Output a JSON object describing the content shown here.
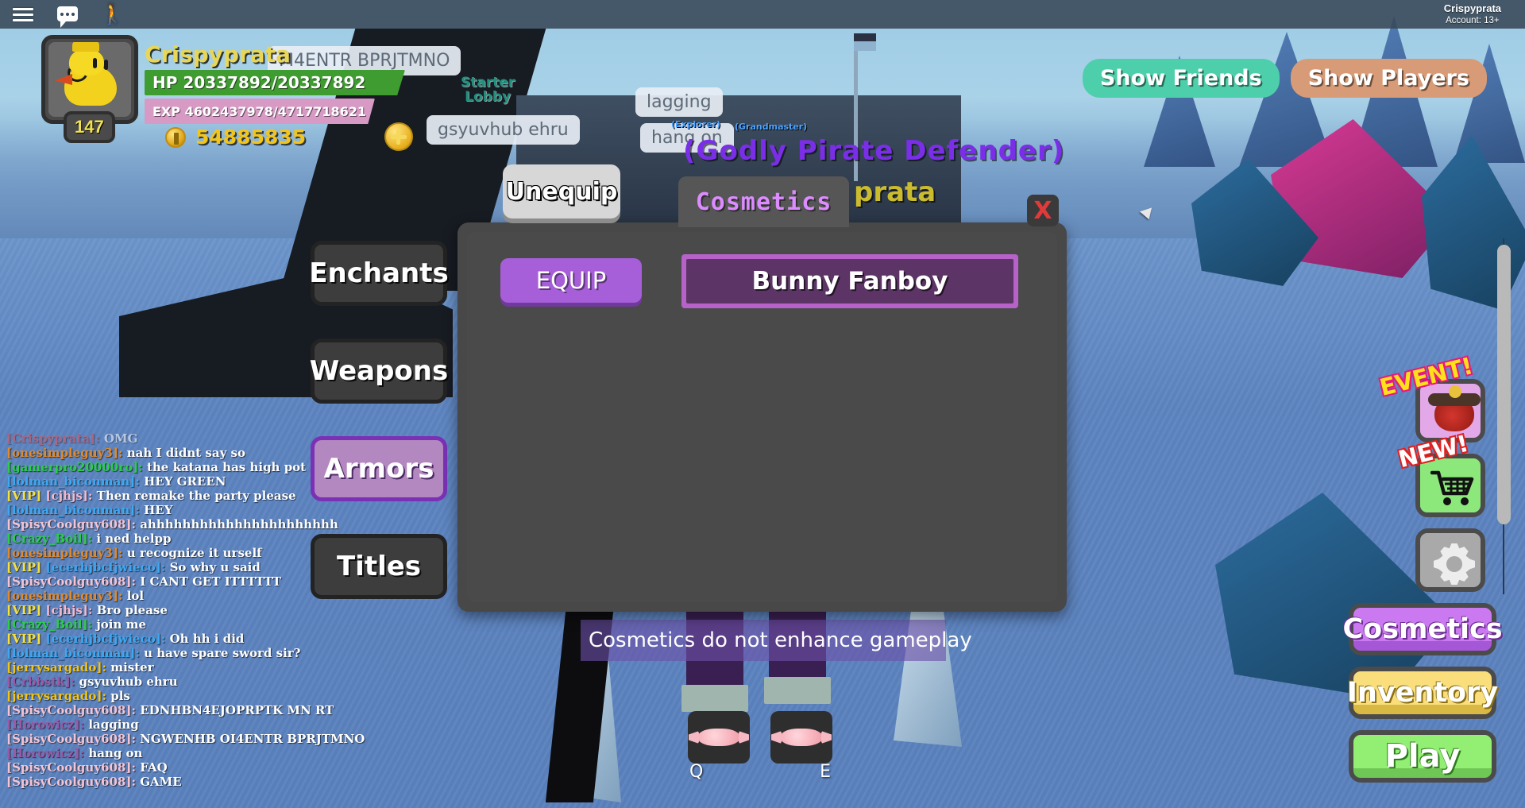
{
  "topbar": {
    "menu_icon": "hamburger-icon",
    "chat_icon": "chat-icon",
    "emote_icon": "person-emote-icon",
    "account_name": "Crispyprata",
    "account_age": "Account: 13+"
  },
  "hud": {
    "player_name": "Crispyprata",
    "level": "147",
    "hp_text": "HP 20337892/20337892",
    "exp_text": "EXP 4602437978/4717718621",
    "coins": "54885835",
    "add_coins_label": "+"
  },
  "top_right": {
    "show_friends": "Show Friends",
    "show_players": "Show Players"
  },
  "world": {
    "starter_lobby": "Starter\nLobby",
    "bubbles": [
      {
        "text": "М4ENTR BPRJTMNO"
      },
      {
        "text": "lagging"
      },
      {
        "text": "gsyuvhub ehru"
      },
      {
        "text": "hang on"
      }
    ],
    "overhead_titles": {
      "godly": "(Godly Pirate Defender)",
      "player": "prata",
      "grandmaster": "(Grandmaster)",
      "explorer": "(Explorer)"
    }
  },
  "left_tabs": [
    {
      "label": "Enchants",
      "active": false
    },
    {
      "label": "Weapons",
      "active": false
    },
    {
      "label": "Armors",
      "active": true
    },
    {
      "label": "Titles",
      "active": false
    }
  ],
  "modal": {
    "title": "Cosmetics",
    "close_label": "X",
    "equip_label": "EQUIP",
    "items": [
      {
        "name": "Bunny Fanboy",
        "selected": true
      }
    ]
  },
  "tooltip": {
    "unequip_label": "Unequip"
  },
  "banner": {
    "text": "Cosmetics do not enhance gameplay"
  },
  "hotbar": [
    {
      "key": "Q",
      "icon": "candy-icon"
    },
    {
      "key": "E",
      "icon": "candy-icon"
    }
  ],
  "right_rail": [
    {
      "type": "icon",
      "name": "event-button",
      "icon": "kabuto-helmet-icon",
      "flag": "EVENT!"
    },
    {
      "type": "icon",
      "name": "shop-button",
      "icon": "shopping-cart-icon",
      "flag": "NEW!"
    },
    {
      "type": "icon",
      "name": "settings-button",
      "icon": "gear-icon",
      "flag": ""
    },
    {
      "type": "text",
      "name": "cosmetics-button",
      "label": "Cosmetics"
    },
    {
      "type": "text",
      "name": "inventory-button",
      "label": "Inventory"
    },
    {
      "type": "text",
      "name": "play-button",
      "label": "Play"
    }
  ],
  "chat": [
    {
      "vip": false,
      "who": "[Crispyprata]:",
      "who_color": "#e05050",
      "msg": "OMG"
    },
    {
      "vip": false,
      "who": "[onesimpleguy3]:",
      "who_color": "#e08a2e",
      "msg": "nah I didnt say so"
    },
    {
      "vip": false,
      "who": "[gamerpro20000ro]:",
      "who_color": "#2ecc4a",
      "msg": "the katana has high pot"
    },
    {
      "vip": false,
      "who": "[lolman_biconman]:",
      "who_color": "#3ea8f0",
      "msg": "HEY GREEN"
    },
    {
      "vip": true,
      "who": "[cjhjs]:",
      "who_color": "#f3b9cc",
      "msg": "Then remake the party please"
    },
    {
      "vip": false,
      "who": "[lolman_biconman]:",
      "who_color": "#3ea8f0",
      "msg": "HEY"
    },
    {
      "vip": false,
      "who": "[SpisyCoolguy608]:",
      "who_color": "#f3c4d4",
      "msg": "ahhhhhhhhhhhhhhhhhhhhhh"
    },
    {
      "vip": false,
      "who": "[Crazy_Boil]:",
      "who_color": "#2ecc4a",
      "msg": "i ned helpp"
    },
    {
      "vip": false,
      "who": "[onesimpleguy3]:",
      "who_color": "#e08a2e",
      "msg": "u recognize it urself"
    },
    {
      "vip": true,
      "who": "[ecerhjbcfjwieco]:",
      "who_color": "#3ea8f0",
      "msg": "So why u said"
    },
    {
      "vip": false,
      "who": "[SpisyCoolguy608]:",
      "who_color": "#f3c4d4",
      "msg": "I CANT GET ITTTTTT"
    },
    {
      "vip": false,
      "who": "[onesimpleguy3]:",
      "who_color": "#e08a2e",
      "msg": "lol"
    },
    {
      "vip": true,
      "who": "[cjhjs]:",
      "who_color": "#f3b9cc",
      "msg": "Bro please"
    },
    {
      "vip": false,
      "who": "[Crazy_Boil]:",
      "who_color": "#2ecc4a",
      "msg": "join me"
    },
    {
      "vip": true,
      "who": "[ecerhjbcfjwieco]:",
      "who_color": "#3ea8f0",
      "msg": "Oh hh i did"
    },
    {
      "vip": false,
      "who": "[lolman_biconman]:",
      "who_color": "#3ea8f0",
      "msg": "u have spare sword sir?"
    },
    {
      "vip": false,
      "who": "[jerrysargado]:",
      "who_color": "#f0c418",
      "msg": "mister"
    },
    {
      "vip": false,
      "who": "[Crbbstk]:",
      "who_color": "#9b5aa8",
      "msg": "gsyuvhub ehru"
    },
    {
      "vip": false,
      "who": "[jerrysargado]:",
      "who_color": "#f0c418",
      "msg": "pls"
    },
    {
      "vip": false,
      "who": "[SpisyCoolguy608]:",
      "who_color": "#f3c4d4",
      "msg": "EDNHBN4EJOPRPTK MN RT"
    },
    {
      "vip": false,
      "who": "[Horowicz]:",
      "who_color": "#9b5aa8",
      "msg": "lagging"
    },
    {
      "vip": false,
      "who": "[SpisyCoolguy608]:",
      "who_color": "#f3c4d4",
      "msg": "NGWENHB OI4ENTR BPRJTMNO"
    },
    {
      "vip": false,
      "who": "[Horowicz]:",
      "who_color": "#9b5aa8",
      "msg": "hang on"
    },
    {
      "vip": false,
      "who": "[SpisyCoolguy608]:",
      "who_color": "#f3c4d4",
      "msg": "FAQ"
    },
    {
      "vip": false,
      "who": "[SpisyCoolguy608]:",
      "who_color": "#f3c4d4",
      "msg": "GAME"
    }
  ],
  "colors": {
    "accent_purple": "#a65fd8",
    "hp_green": "#3f9c30",
    "exp_pink": "#d79ac4",
    "coin_gold": "#f3c41a",
    "close_red": "#e03a3a"
  }
}
